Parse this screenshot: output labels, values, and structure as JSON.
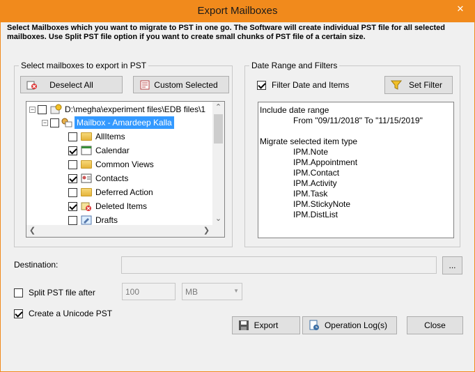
{
  "window": {
    "title": "Export Mailboxes",
    "close_glyph": "✕"
  },
  "description": "Select Mailboxes which you want to migrate to PST in one go. The Software will create individual PST file for all selected mailboxes. Use Split PST file option if you want to create small chunks of PST file of a certain size.",
  "left_group": {
    "label": "Select mailboxes to export in PST",
    "deselect_all": "Deselect All",
    "custom_selected": "Custom Selected",
    "tree": {
      "root": "D:\\megha\\experiment files\\EDB files\\1",
      "mailbox": "Mailbox - Amardeep Kalla",
      "items": [
        {
          "label": "AllItems",
          "checked": false,
          "icon": "folder-icon"
        },
        {
          "label": "Calendar",
          "checked": true,
          "icon": "calendar-icon"
        },
        {
          "label": "Common Views",
          "checked": false,
          "icon": "folder-icon"
        },
        {
          "label": "Contacts",
          "checked": true,
          "icon": "contacts-icon"
        },
        {
          "label": "Deferred Action",
          "checked": false,
          "icon": "folder-icon"
        },
        {
          "label": "Deleted Items",
          "checked": true,
          "icon": "deleted-items-icon"
        },
        {
          "label": "Drafts",
          "checked": false,
          "icon": "drafts-icon"
        }
      ]
    }
  },
  "right_group": {
    "label": "Date Range and Filters",
    "filter_label": "Filter Date and Items",
    "filter_checked": true,
    "set_filter": "Set Filter",
    "summary": {
      "line1": "Include date range",
      "line2": "From \"09/11/2018\" To \"11/15/2019\"",
      "line3": "Migrate selected item type",
      "types": [
        "IPM.Note",
        "IPM.Appointment",
        "IPM.Contact",
        "IPM.Activity",
        "IPM.Task",
        "IPM.StickyNote",
        "IPM.DistList"
      ]
    }
  },
  "destination": {
    "label": "Destination:",
    "value": "",
    "browse": "..."
  },
  "split": {
    "label": "Split PST file after",
    "checked": false,
    "value": "100",
    "unit": "MB"
  },
  "unicode": {
    "label": "Create a Unicode PST",
    "checked": true
  },
  "buttons": {
    "export": "Export",
    "operation_log": "Operation Log(s)",
    "close": "Close"
  },
  "colors": {
    "title_bar": "#f18a1c",
    "selection": "#3399ff"
  }
}
